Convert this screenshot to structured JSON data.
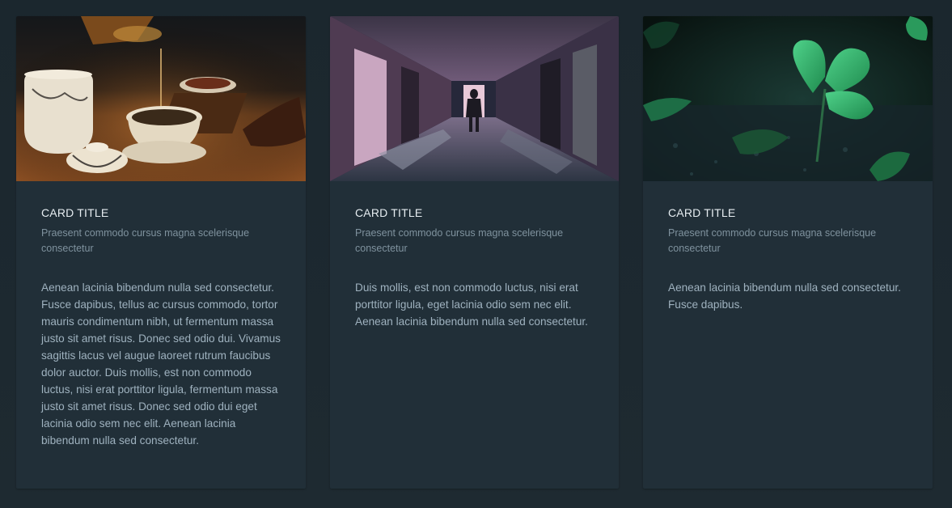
{
  "cards": [
    {
      "image": "tea-ceremony-photo",
      "title": "CARD TITLE",
      "subtitle": "Praesent commodo cursus magna scelerisque consectetur",
      "text": "Aenean lacinia bibendum nulla sed consectetur. Fusce dapibus, tellus ac cursus commodo, tortor mauris condimentum nibh, ut fermentum massa justo sit amet risus. Donec sed odio dui. Vivamus sagittis lacus vel augue laoreet rutrum faucibus dolor auctor. Duis mollis, est non commodo luctus, nisi erat porttitor ligula, fermentum massa justo sit amet risus. Donec sed odio dui eget lacinia odio sem nec elit. Aenean lacinia bibendum nulla sed consectetur."
    },
    {
      "image": "abandoned-hallway-photo",
      "title": "CARD TITLE",
      "subtitle": "Praesent commodo cursus magna scelerisque consectetur",
      "text": "Duis mollis, est non commodo luctus, nisi erat porttitor ligula, eget lacinia odio sem nec elit. Aenean lacinia bibendum nulla sed consectetur."
    },
    {
      "image": "strawberry-leaf-photo",
      "title": "CARD TITLE",
      "subtitle": "Praesent commodo cursus magna scelerisque consectetur",
      "text": "Aenean lacinia bibendum nulla sed consectetur. Fusce dapibus."
    }
  ],
  "colors": {
    "page_background": "#1d2a31",
    "card_background": "#212f38",
    "title_text": "#e6edf1",
    "subtitle_text": "#7f929e",
    "body_text": "#9fb2bf"
  }
}
